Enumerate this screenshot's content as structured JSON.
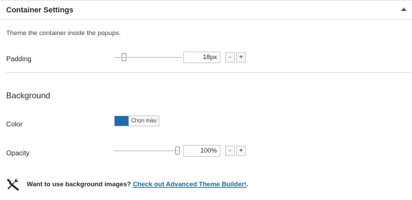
{
  "header": {
    "title": "Container Settings",
    "toggle_icon": "arrow-up-icon"
  },
  "description": "Theme the container inside the popups.",
  "padding": {
    "label": "Padding",
    "value": "18",
    "unit": "px",
    "level": 0.12,
    "minus": "-",
    "plus": "+"
  },
  "background": {
    "title": "Background",
    "color": {
      "label": "Color",
      "button_label": "Chọn màu",
      "swatch": "#1e6cb2"
    },
    "opacity": {
      "label": "Opacity",
      "value": "100",
      "unit": "%",
      "level": 1.0,
      "minus": "-",
      "plus": "+"
    }
  },
  "promo": {
    "icon": "tools-icon",
    "text": "Want to use background images?",
    "link_text": "Check out Advanced Theme Builder!",
    "suffix": "."
  }
}
